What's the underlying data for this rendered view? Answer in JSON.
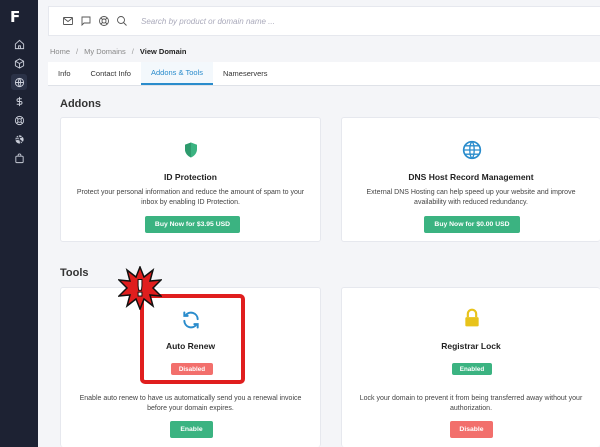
{
  "sidebar": {
    "logo": "F",
    "items": [
      {
        "icon": "home-icon"
      },
      {
        "icon": "box-icon"
      },
      {
        "icon": "globe-icon",
        "active": true
      },
      {
        "icon": "dollar-icon"
      },
      {
        "icon": "lifebuoy-icon"
      },
      {
        "icon": "dribbble-icon"
      },
      {
        "icon": "bag-icon"
      }
    ]
  },
  "topbar": {
    "icons": [
      "mail-icon",
      "chat-icon",
      "support-icon",
      "search-icon"
    ],
    "search_placeholder": "Search by product or domain name ..."
  },
  "breadcrumb": {
    "items": [
      "Home",
      "My Domains"
    ],
    "current": "View Domain"
  },
  "tabs": [
    {
      "label": "Info"
    },
    {
      "label": "Contact Info"
    },
    {
      "label": "Addons & Tools",
      "active": true
    },
    {
      "label": "Nameservers"
    }
  ],
  "addons": {
    "title": "Addons",
    "cards": [
      {
        "icon": "shield-icon",
        "title": "ID Protection",
        "description": "Protect your personal information and reduce the amount of spam to your inbox by enabling ID Protection.",
        "button": "Buy Now for $3.95 USD"
      },
      {
        "icon": "globe-icon",
        "title": "DNS Host Record Management",
        "description": "External DNS Hosting can help speed up your website and improve availability with reduced redundancy.",
        "button": "Buy Now for $0.00 USD"
      }
    ]
  },
  "tools": {
    "title": "Tools",
    "cards": [
      {
        "icon": "refresh-icon",
        "title": "Auto Renew",
        "status": "Disabled",
        "description": "Enable auto renew to have us automatically send you a renewal invoice before your domain expires.",
        "button": "Enable"
      },
      {
        "icon": "lock-icon",
        "title": "Registrar Lock",
        "status": "Enabled",
        "description": "Lock your domain to prevent it from being transferred away without your authorization.",
        "button": "Disable"
      }
    ]
  },
  "annotation": {
    "mark": "!"
  },
  "colors": {
    "sidebar_bg": "#1d2233",
    "accent_blue": "#2a8ccc",
    "green": "#3bb381",
    "red": "#f26f6c",
    "shield": "#3bb381",
    "lock": "#e8c31b",
    "highlight": "#e01e1e"
  }
}
